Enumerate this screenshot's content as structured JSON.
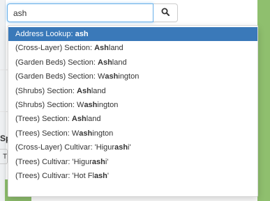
{
  "search": {
    "value": "ash"
  },
  "background": {
    "partial_label": "Sp",
    "partial_button": "T"
  },
  "suggestions": [
    {
      "prefix": "Address Lookup: ",
      "pre": "",
      "match": "ash",
      "post": "",
      "active": true
    },
    {
      "prefix": "(Cross-Layer) Section: ",
      "pre": "",
      "match": "Ash",
      "post": "land",
      "active": false
    },
    {
      "prefix": "(Garden Beds) Section: ",
      "pre": "",
      "match": "Ash",
      "post": "land",
      "active": false
    },
    {
      "prefix": "(Garden Beds) Section: ",
      "pre": "W",
      "match": "ash",
      "post": "ington",
      "active": false
    },
    {
      "prefix": "(Shrubs) Section: ",
      "pre": "",
      "match": "Ash",
      "post": "land",
      "active": false
    },
    {
      "prefix": "(Shrubs) Section: ",
      "pre": "W",
      "match": "ash",
      "post": "ington",
      "active": false
    },
    {
      "prefix": "(Trees) Section: ",
      "pre": "",
      "match": "Ash",
      "post": "land",
      "active": false
    },
    {
      "prefix": "(Trees) Section: ",
      "pre": "W",
      "match": "ash",
      "post": "ington",
      "active": false
    },
    {
      "prefix": "(Cross-Layer) Cultivar: ",
      "pre": "'Higur",
      "match": "ash",
      "post": "i'",
      "active": false
    },
    {
      "prefix": "(Trees) Cultivar: ",
      "pre": "'Higur",
      "match": "ash",
      "post": "i'",
      "active": false
    },
    {
      "prefix": "(Trees) Cultivar: ",
      "pre": "'Hot Fl",
      "match": "ash",
      "post": "'",
      "active": false
    }
  ]
}
